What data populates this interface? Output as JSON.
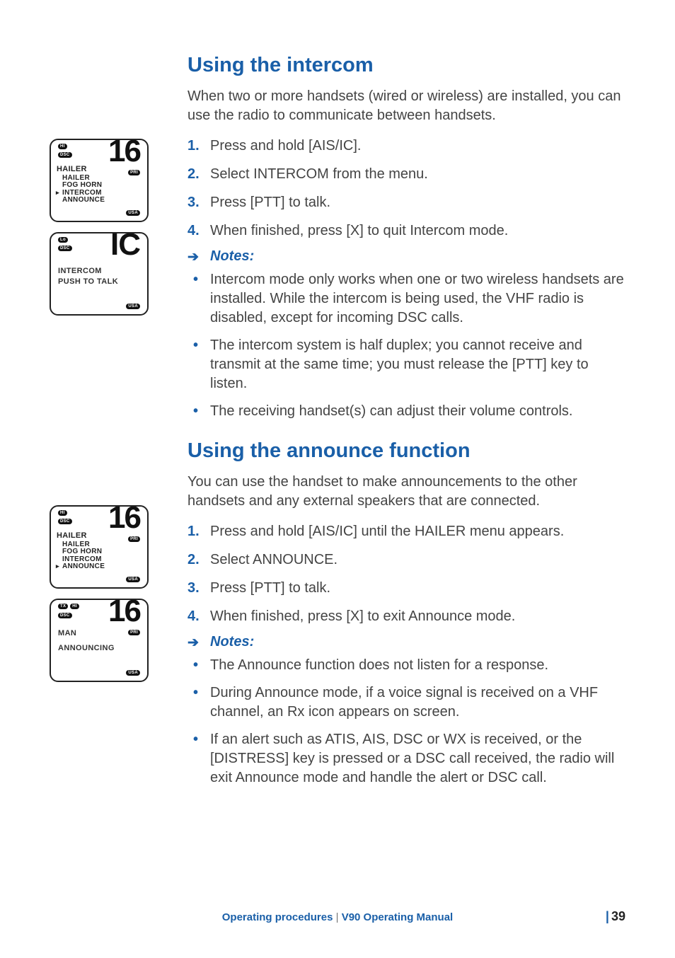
{
  "section1": {
    "heading": "Using the intercom",
    "intro": "When two or more handsets (wired or wireless) are installed, you can use the radio to communicate between handsets.",
    "steps": [
      "Press and hold [AIS/IC].",
      "Select INTERCOM from the menu.",
      "Press [PTT] to talk.",
      "When finished, press [X] to quit Intercom mode."
    ],
    "notes_label": "Notes:",
    "notes": [
      "Intercom mode only works when one or two wireless handsets are installed. While the intercom is being used, the VHF radio is disabled, except for incoming DSC calls.",
      "The intercom system is half duplex; you cannot receive and transmit at the same time; you must release the [PTT] key to listen.",
      "The receiving handset(s) can adjust their volume controls."
    ]
  },
  "section2": {
    "heading": "Using the announce function",
    "intro": "You can use the handset to make announcements to the other handsets and any external speakers that are connected.",
    "steps": [
      "Press and hold [AIS/IC] until the HAILER menu appears.",
      "Select ANNOUNCE.",
      "Press [PTT] to talk.",
      "When finished, press [X] to exit Announce mode."
    ],
    "notes_label": "Notes:",
    "notes": [
      "The Announce function does not listen for a response.",
      "During Announce mode, if a voice signal is received on a VHF channel, an Rx icon appears on screen.",
      "If an alert such as ATIS, AIS, DSC or WX is received, or the [DISTRESS] key is pressed or a DSC call received, the radio will exit Announce mode and handle the alert or DSC call."
    ]
  },
  "lcd1": {
    "pill_top1": "HI",
    "pill_top2": "DSC",
    "big": "16",
    "pill_pri": "PRI",
    "pill_usa": "USA",
    "menu_title": "HAILER",
    "items": [
      "HAILER",
      "FOG HORN",
      "INTERCOM",
      "ANNOUNCE"
    ],
    "selected_index": 2
  },
  "lcd2": {
    "pill_top1": "Lo",
    "pill_top2": "DSC",
    "big": "IC",
    "pill_usa": "USA",
    "line1": "INTERCOM",
    "line2": "PUSH TO TALK"
  },
  "lcd3": {
    "pill_top1": "HI",
    "pill_top2": "DSC",
    "big": "16",
    "pill_pri": "PRI",
    "pill_usa": "USA",
    "menu_title": "HAILER",
    "items": [
      "HAILER",
      "FOG HORN",
      "INTERCOM",
      "ANNOUNCE"
    ],
    "selected_index": 3
  },
  "lcd4": {
    "pill_top1": "TX",
    "pill_top1b": "HI",
    "pill_top2": "DSC",
    "big": "16",
    "pill_pri": "PRI",
    "pill_usa": "USA",
    "line1": "MAN",
    "line2": "ANNOUNCING"
  },
  "footer": {
    "section": "Operating procedures",
    "sep": " | ",
    "manual": "V90 Operating Manual",
    "page_prefix": "| ",
    "page": "39"
  }
}
